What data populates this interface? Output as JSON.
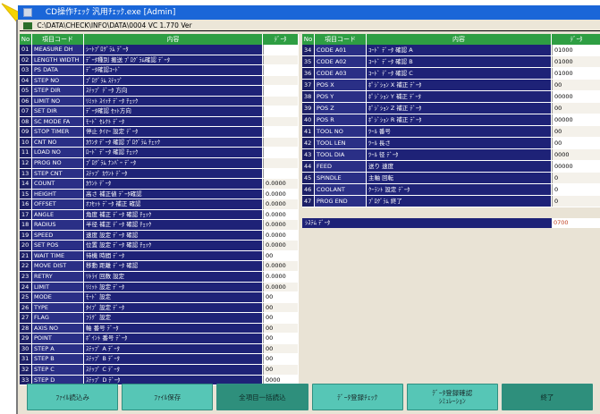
{
  "window": {
    "title": "CD操作ﾁｪｯｸ 汎用ﾁｪｯｸ.exe [Admin]",
    "status_text": "C:\\DATA\\CHECK\\INFO\\DATA\\0004 VC 1.770 Ver"
  },
  "left_table": {
    "headers": [
      "No",
      "項目コード",
      "内容",
      "ﾃﾞｰﾀ"
    ],
    "rows": [
      {
        "no": "01",
        "code": "MEASURE DH",
        "desc": "ｼｰﾄﾌﾟﾛｸﾞﾗﾑ ﾃﾞｰﾀ",
        "value": ""
      },
      {
        "no": "02",
        "code": "LENGTH WIDTH",
        "desc": "ﾃﾞｰﾀ種別 搬送 ﾌﾟﾛｸﾞﾗﾑ確認 ﾃﾞｰﾀ",
        "value": ""
      },
      {
        "no": "03",
        "code": "PS DATA",
        "desc": "ﾃﾞｰﾀ確認ｺｰﾄﾞ",
        "value": ""
      },
      {
        "no": "04",
        "code": "STEP NO",
        "desc": "ﾌﾟﾛｸﾞﾗﾑ ｽﾃｯﾌﾟ",
        "value": ""
      },
      {
        "no": "05",
        "code": "STEP DIR",
        "desc": "ｽﾃｯﾌﾟ ﾃﾞｰﾀ 方向",
        "value": ""
      },
      {
        "no": "06",
        "code": "LIMIT NO",
        "desc": "ﾘﾐｯﾄ ｽｲｯﾁ ﾃﾞｰﾀ ﾁｪｯｸ",
        "value": ""
      },
      {
        "no": "07",
        "code": "SET DIR",
        "desc": "ﾃﾞｰﾀ確認 ｾｯﾄ方向",
        "value": ""
      },
      {
        "no": "08",
        "code": "SC MODE FA",
        "desc": "ﾓｰﾄﾞ ｾﾚｸﾄ ﾃﾞｰﾀ",
        "value": ""
      },
      {
        "no": "09",
        "code": "STOP TIMER",
        "desc": "停止 ﾀｲﾏｰ 設定 ﾃﾞｰﾀ",
        "value": ""
      },
      {
        "no": "10",
        "code": "CNT NO",
        "desc": "ｶｳﾝﾀ ﾃﾞｰﾀ 確認 ﾌﾟﾛｸﾞﾗﾑ ﾁｪｯｸ",
        "value": ""
      },
      {
        "no": "11",
        "code": "LOAD NO",
        "desc": "ﾛｰﾄﾞ ﾃﾞｰﾀ 確認 ﾁｪｯｸ",
        "value": ""
      },
      {
        "no": "12",
        "code": "PROG NO",
        "desc": "ﾌﾟﾛｸﾞﾗﾑ ﾅﾝﾊﾞｰ ﾃﾞｰﾀ",
        "value": ""
      },
      {
        "no": "13",
        "code": "STEP CNT",
        "desc": "ｽﾃｯﾌﾟ ｶｳﾝﾄ ﾃﾞｰﾀ",
        "value": ""
      },
      {
        "no": "14",
        "code": "COUNT",
        "desc": "ｶｳﾝﾄ ﾃﾞｰﾀ",
        "value": "0.0000"
      },
      {
        "no": "15",
        "code": "HEIGHT",
        "desc": "高さ 補正値 ﾃﾞｰﾀ確認",
        "value": "0.0000"
      },
      {
        "no": "16",
        "code": "OFFSET",
        "desc": "ｵﾌｾｯﾄ ﾃﾞｰﾀ 補正 確認",
        "value": "0.0000"
      },
      {
        "no": "17",
        "code": "ANGLE",
        "desc": "角度 補正 ﾃﾞｰﾀ 確認 ﾁｪｯｸ",
        "value": "0.0000"
      },
      {
        "no": "18",
        "code": "RADIUS",
        "desc": "半径 補正 ﾃﾞｰﾀ 確認 ﾁｪｯｸ",
        "value": "0.0000"
      },
      {
        "no": "19",
        "code": "SPEED",
        "desc": "速度 設定 ﾃﾞｰﾀ 確認",
        "value": "0.0000"
      },
      {
        "no": "20",
        "code": "SET POS",
        "desc": "位置 設定 ﾃﾞｰﾀ 確認 ﾁｪｯｸ",
        "value": "0.0000"
      },
      {
        "no": "21",
        "code": "WAIT TIME",
        "desc": "待機 時間 ﾃﾞｰﾀ",
        "value": "00"
      },
      {
        "no": "22",
        "code": "MOVE DIST",
        "desc": "移動 距離 ﾃﾞｰﾀ 確認",
        "value": "0.0000"
      },
      {
        "no": "23",
        "code": "RETRY",
        "desc": "ﾘﾄﾗｲ 回数 設定",
        "value": "0.0000"
      },
      {
        "no": "24",
        "code": "LIMIT",
        "desc": "ﾘﾐｯﾄ 設定 ﾃﾞｰﾀ",
        "value": "0.0000"
      },
      {
        "no": "25",
        "code": "MODE",
        "desc": "ﾓｰﾄﾞ 設定",
        "value": "00"
      },
      {
        "no": "26",
        "code": "TYPE",
        "desc": "ﾀｲﾌﾟ 設定 ﾃﾞｰﾀ",
        "value": "00"
      },
      {
        "no": "27",
        "code": "FLAG",
        "desc": "ﾌﾗｸﾞ 設定",
        "value": "00"
      },
      {
        "no": "28",
        "code": "AXIS NO",
        "desc": "軸 番号 ﾃﾞｰﾀ",
        "value": "00"
      },
      {
        "no": "29",
        "code": "POINT",
        "desc": "ﾎﾟｲﾝﾄ 番号 ﾃﾞｰﾀ",
        "value": "00"
      },
      {
        "no": "30",
        "code": "STEP A",
        "desc": "ｽﾃｯﾌﾟ A ﾃﾞｰﾀ",
        "value": "00"
      },
      {
        "no": "31",
        "code": "STEP B",
        "desc": "ｽﾃｯﾌﾟ B ﾃﾞｰﾀ",
        "value": "00"
      },
      {
        "no": "32",
        "code": "STEP C",
        "desc": "ｽﾃｯﾌﾟ C ﾃﾞｰﾀ",
        "value": "00"
      },
      {
        "no": "33",
        "code": "STEP D",
        "desc": "ｽﾃｯﾌﾟ D ﾃﾞｰﾀ",
        "value": "0000"
      }
    ]
  },
  "right_table": {
    "headers": [
      "No",
      "項目コード",
      "内容",
      "ﾃﾞｰﾀ"
    ],
    "rows": [
      {
        "no": "34",
        "code": "CODE A01",
        "desc": "ｺｰﾄﾞ ﾃﾞｰﾀ 確認 A",
        "value": "01000"
      },
      {
        "no": "35",
        "code": "CODE A02",
        "desc": "ｺｰﾄﾞ ﾃﾞｰﾀ 確認 B",
        "value": "01000"
      },
      {
        "no": "36",
        "code": "CODE A03",
        "desc": "ｺｰﾄﾞ ﾃﾞｰﾀ 確認 C",
        "value": "01000"
      },
      {
        "no": "37",
        "code": "POS X",
        "desc": "ﾎﾟｼﾞｼｮﾝ X 補正 ﾃﾞｰﾀ",
        "value": "00"
      },
      {
        "no": "38",
        "code": "POS Y",
        "desc": "ﾎﾟｼﾞｼｮﾝ Y 補正 ﾃﾞｰﾀ",
        "value": "00000"
      },
      {
        "no": "39",
        "code": "POS Z",
        "desc": "ﾎﾟｼﾞｼｮﾝ Z 補正 ﾃﾞｰﾀ",
        "value": "00"
      },
      {
        "no": "40",
        "code": "POS R",
        "desc": "ﾎﾟｼﾞｼｮﾝ R 補正 ﾃﾞｰﾀ",
        "value": "00000"
      },
      {
        "no": "41",
        "code": "TOOL NO",
        "desc": "ﾂｰﾙ 番号",
        "value": "00"
      },
      {
        "no": "42",
        "code": "TOOL LEN",
        "desc": "ﾂｰﾙ 長さ",
        "value": "00"
      },
      {
        "no": "43",
        "code": "TOOL DIA",
        "desc": "ﾂｰﾙ 径 ﾃﾞｰﾀ",
        "value": "0000"
      },
      {
        "no": "44",
        "code": "FEED",
        "desc": "送り 速度",
        "value": "00000"
      },
      {
        "no": "45",
        "code": "SPINDLE",
        "desc": "主軸 回転",
        "value": "0"
      },
      {
        "no": "46",
        "code": "COOLANT",
        "desc": "ｸｰﾗﾝﾄ 設定 ﾃﾞｰﾀ",
        "value": "0"
      },
      {
        "no": "47",
        "code": "PROG END",
        "desc": "ﾌﾟﾛｸﾞﾗﾑ 終了",
        "value": "0"
      }
    ],
    "summary_label": "ｼｽﾃﾑ ﾃﾞｰﾀ",
    "summary_value": "0700"
  },
  "buttons": [
    {
      "label": "ﾌｧｲﾙ読込み",
      "style": "light"
    },
    {
      "label": "ﾌｧｲﾙ保存",
      "style": "light"
    },
    {
      "label": "全項目一括読込",
      "style": "dark"
    },
    {
      "label": "ﾃﾞｰﾀ登録ﾁｪｯｸ",
      "style": "light"
    },
    {
      "label": "ﾃﾞｰﾀ登録確認\nｼﾐｭﾚｰｼｮﾝ",
      "style": "light"
    },
    {
      "label": "終了",
      "style": "dark"
    }
  ],
  "colors": {
    "title_bar": "#1a66d8",
    "header_green": "#2e9e43",
    "row_navy": "#1e2277",
    "button_teal": "#56c6b6",
    "arrow_yellow": "#f4d400"
  }
}
